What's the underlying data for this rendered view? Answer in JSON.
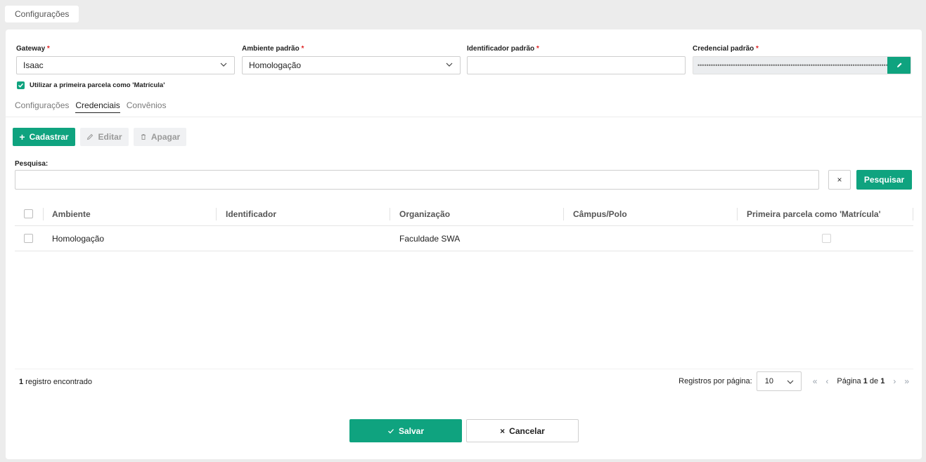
{
  "top_tab": "Configurações",
  "fields": {
    "gateway": {
      "label": "Gateway",
      "required": "*",
      "value": "Isaac"
    },
    "ambiente": {
      "label": "Ambiente padrão",
      "required": "*",
      "value": "Homologação"
    },
    "identificador": {
      "label": "Identificador padrão",
      "required": "*",
      "value": ""
    },
    "credencial": {
      "label": "Credencial padrão",
      "required": "*",
      "value": "••••••••••••••••••••••••••••••••••••••••••••••••••••••••••••••••••••••••••••••••••••••••"
    }
  },
  "checkbox_matricula": {
    "label": "Utilizar a primeira parcela como 'Matrícula'",
    "checked": true
  },
  "tabs": [
    "Configurações",
    "Credenciais",
    "Convênios"
  ],
  "active_tab": "Credenciais",
  "toolbar": {
    "add": "Cadastrar",
    "edit": "Editar",
    "delete": "Apagar"
  },
  "search": {
    "label": "Pesquisa:",
    "value": "",
    "clear": "×",
    "button": "Pesquisar"
  },
  "grid": {
    "columns": [
      "Ambiente",
      "Identificador",
      "Organização",
      "Câmpus/Polo",
      "Primeira parcela como 'Matrícula'"
    ],
    "rows": [
      {
        "ambiente": "Homologação",
        "identificador": "",
        "organizacao": "Faculdade SWA",
        "campus": "",
        "primeira_parcela": false
      }
    ]
  },
  "footer": {
    "count_number": "1",
    "count_text": " registro encontrado",
    "per_page_label": "Registros por página:",
    "per_page_value": "10",
    "page_label": "Página ",
    "page_current": "1",
    "page_of": " de ",
    "page_total": "1"
  },
  "actions": {
    "save": "Salvar",
    "cancel": "Cancelar"
  },
  "colors": {
    "accent": "#0fa37f",
    "required": "#e02424"
  }
}
